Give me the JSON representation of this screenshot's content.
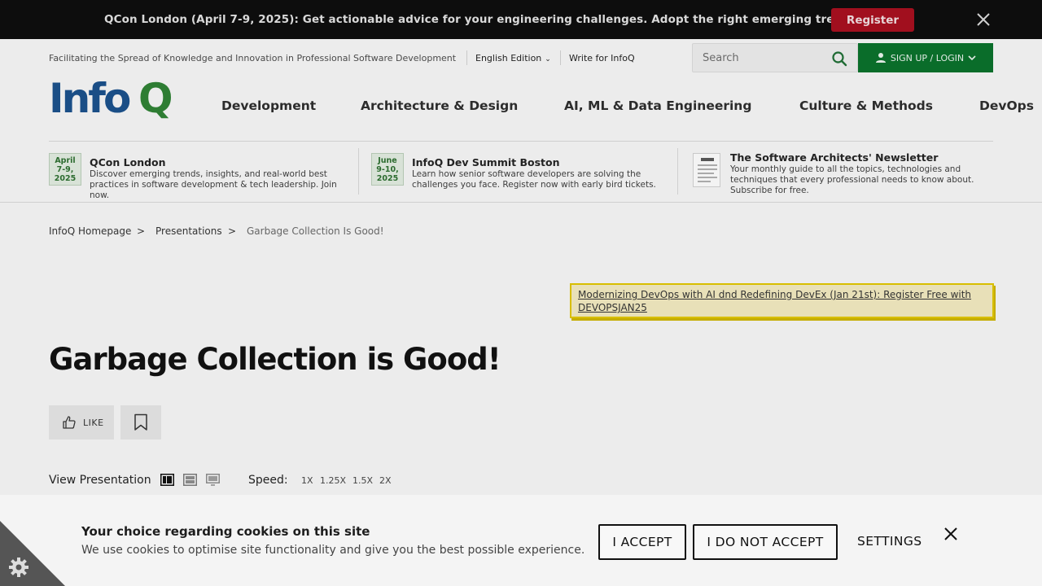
{
  "promo_banner": {
    "text": "QCon London (April 7-9, 2025): Get actionable advice for your engineering challenges. Adopt the right emerging trends.",
    "register_label": "Register"
  },
  "utility": {
    "tagline": "Facilitating the Spread of Knowledge and Innovation in Professional Software Development",
    "edition_label": "English Edition",
    "write_label": "Write for InfoQ"
  },
  "search": {
    "placeholder": "Search"
  },
  "auth": {
    "signup_label": "SIGN UP / LOGIN"
  },
  "logo": {
    "text_blue": "Info",
    "text_green": "Q"
  },
  "nav": {
    "items": [
      {
        "label": "Development"
      },
      {
        "label": "Architecture & Design"
      },
      {
        "label": "AI, ML & Data Engineering"
      },
      {
        "label": "Culture & Methods"
      },
      {
        "label": "DevOps"
      }
    ]
  },
  "promos": [
    {
      "date_lines": [
        "April",
        "7-9,",
        "2025"
      ],
      "title": "QCon London",
      "description": "Discover emerging trends, insights, and real-world best practices in software development & tech leadership. Join now."
    },
    {
      "date_lines": [
        "June",
        "9-10,",
        "2025"
      ],
      "title": "InfoQ Dev Summit Boston",
      "description": "Learn how senior software developers are solving the challenges you face. Register now with early bird tickets."
    },
    {
      "title": "The Software Architects' Newsletter",
      "description": "Your monthly guide to all the topics, technologies and techniques that every professional needs to know about. Subscribe for free."
    }
  ],
  "breadcrumb": {
    "items": [
      "InfoQ Homepage",
      "Presentations",
      "Garbage Collection Is Good!"
    ],
    "separator": ">"
  },
  "notice": {
    "text": "Modernizing DevOps with AI dnd Redefining DevEx (Jan 21st): Register Free with DEVOPSJAN25"
  },
  "article": {
    "title": "Garbage Collection is Good!",
    "like_label": "LIKE"
  },
  "player": {
    "view_label": "View Presentation",
    "speed_label": "Speed:",
    "speeds": [
      "1X",
      "1.25X",
      "1.5X",
      "2X"
    ]
  },
  "cookie": {
    "title": "Your choice regarding cookies on this site",
    "text": "We use cookies to optimise site functionality and give you the best possible experience.",
    "accept_label": "I ACCEPT",
    "reject_label": "I DO NOT ACCEPT",
    "settings_label": "SETTINGS"
  },
  "colors": {
    "brand_blue": "#1a4e86",
    "brand_green": "#2e7d33",
    "register_red": "#a10f1e",
    "signup_green": "#0a6d2a",
    "notice_yellow": "#d8be00"
  }
}
